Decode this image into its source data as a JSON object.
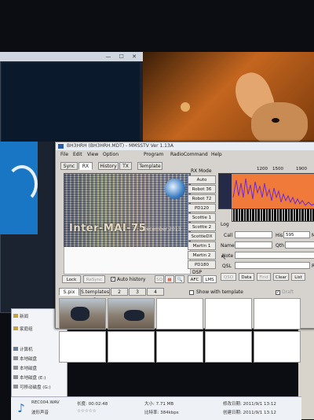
{
  "app": {
    "title": "BH3HRH (BH3HRH.MDT) - MMSSTV Ver 1.13A",
    "menu": [
      "File",
      "Edit",
      "View",
      "Option",
      "Program",
      "RadioCommand",
      "Help"
    ]
  },
  "tabs": [
    "Sync",
    "RX",
    "History",
    "TX",
    "Template"
  ],
  "rx_image": {
    "callsign": "Inter-MAI-75",
    "date": "December 2013"
  },
  "rx_mode": {
    "label": "RX Mode",
    "modes": [
      "Auto",
      "Robot 36",
      "Robot 72",
      "PD120",
      "Scottie 1",
      "Scottie 2",
      "ScottieDX",
      "Martin 1",
      "Martin 2",
      "PD180"
    ],
    "dsp_label": "DSP",
    "afc": "AFC",
    "lms": "LMS"
  },
  "spectrum": {
    "ticks": [
      "1200",
      "1500",
      "1900"
    ],
    "color": "#f07a3a"
  },
  "log": {
    "label": "Log",
    "call_label": "Call",
    "his_label": "His",
    "his_value": "595",
    "my_label": "My",
    "name_label": "Name",
    "qth_label": "Qth",
    "note_label": "Note",
    "qsl_label": "QSL",
    "r_label": "R"
  },
  "rx_buttons": {
    "lock": "Lock",
    "rebuild": "ReSync",
    "auto_history": "Auto history"
  },
  "log_buttons": {
    "qso": "QSO",
    "data": "Data",
    "find": "Find",
    "clear": "Clear",
    "list": "List"
  },
  "template_bar": {
    "s_pix": "S.pix",
    "s_templates": "S.templates 1",
    "pages": [
      "2",
      "3",
      "4"
    ],
    "show_with_template": "Show with template",
    "draft": "Draft"
  },
  "explorer": {
    "items": [
      "新闻",
      "家庭组",
      "计算机",
      "本地磁盘",
      "本地磁盘",
      "本地磁盘 (E:)",
      "可移动磁盘 (G:)"
    ]
  },
  "status": {
    "filename": "REC004.WAV",
    "type": "波形声音",
    "length_label": "长度: 00:02:48",
    "size_label": "大小: 7.71 MB",
    "bitrate_label": "比特率: 384kbps",
    "modified": "修改日期: 2011/9/1 13:12",
    "created": "创建日期: 2011/9/1 13:12"
  }
}
